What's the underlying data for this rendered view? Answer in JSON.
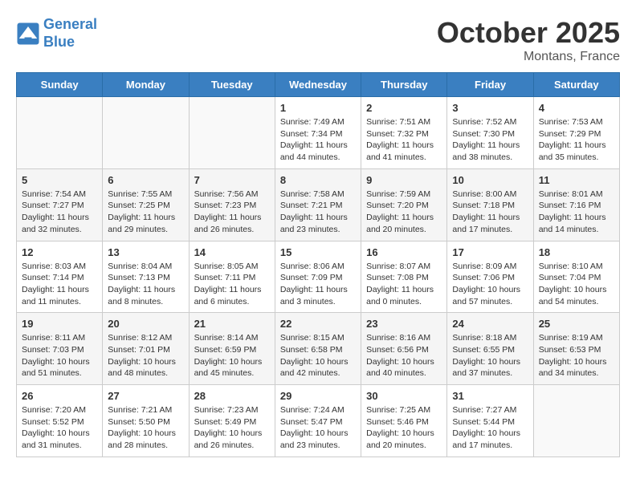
{
  "header": {
    "logo_line1": "General",
    "logo_line2": "Blue",
    "month": "October 2025",
    "location": "Montans, France"
  },
  "days_of_week": [
    "Sunday",
    "Monday",
    "Tuesday",
    "Wednesday",
    "Thursday",
    "Friday",
    "Saturday"
  ],
  "weeks": [
    [
      {
        "day": "",
        "info": ""
      },
      {
        "day": "",
        "info": ""
      },
      {
        "day": "",
        "info": ""
      },
      {
        "day": "1",
        "info": "Sunrise: 7:49 AM\nSunset: 7:34 PM\nDaylight: 11 hours and 44 minutes."
      },
      {
        "day": "2",
        "info": "Sunrise: 7:51 AM\nSunset: 7:32 PM\nDaylight: 11 hours and 41 minutes."
      },
      {
        "day": "3",
        "info": "Sunrise: 7:52 AM\nSunset: 7:30 PM\nDaylight: 11 hours and 38 minutes."
      },
      {
        "day": "4",
        "info": "Sunrise: 7:53 AM\nSunset: 7:29 PM\nDaylight: 11 hours and 35 minutes."
      }
    ],
    [
      {
        "day": "5",
        "info": "Sunrise: 7:54 AM\nSunset: 7:27 PM\nDaylight: 11 hours and 32 minutes."
      },
      {
        "day": "6",
        "info": "Sunrise: 7:55 AM\nSunset: 7:25 PM\nDaylight: 11 hours and 29 minutes."
      },
      {
        "day": "7",
        "info": "Sunrise: 7:56 AM\nSunset: 7:23 PM\nDaylight: 11 hours and 26 minutes."
      },
      {
        "day": "8",
        "info": "Sunrise: 7:58 AM\nSunset: 7:21 PM\nDaylight: 11 hours and 23 minutes."
      },
      {
        "day": "9",
        "info": "Sunrise: 7:59 AM\nSunset: 7:20 PM\nDaylight: 11 hours and 20 minutes."
      },
      {
        "day": "10",
        "info": "Sunrise: 8:00 AM\nSunset: 7:18 PM\nDaylight: 11 hours and 17 minutes."
      },
      {
        "day": "11",
        "info": "Sunrise: 8:01 AM\nSunset: 7:16 PM\nDaylight: 11 hours and 14 minutes."
      }
    ],
    [
      {
        "day": "12",
        "info": "Sunrise: 8:03 AM\nSunset: 7:14 PM\nDaylight: 11 hours and 11 minutes."
      },
      {
        "day": "13",
        "info": "Sunrise: 8:04 AM\nSunset: 7:13 PM\nDaylight: 11 hours and 8 minutes."
      },
      {
        "day": "14",
        "info": "Sunrise: 8:05 AM\nSunset: 7:11 PM\nDaylight: 11 hours and 6 minutes."
      },
      {
        "day": "15",
        "info": "Sunrise: 8:06 AM\nSunset: 7:09 PM\nDaylight: 11 hours and 3 minutes."
      },
      {
        "day": "16",
        "info": "Sunrise: 8:07 AM\nSunset: 7:08 PM\nDaylight: 11 hours and 0 minutes."
      },
      {
        "day": "17",
        "info": "Sunrise: 8:09 AM\nSunset: 7:06 PM\nDaylight: 10 hours and 57 minutes."
      },
      {
        "day": "18",
        "info": "Sunrise: 8:10 AM\nSunset: 7:04 PM\nDaylight: 10 hours and 54 minutes."
      }
    ],
    [
      {
        "day": "19",
        "info": "Sunrise: 8:11 AM\nSunset: 7:03 PM\nDaylight: 10 hours and 51 minutes."
      },
      {
        "day": "20",
        "info": "Sunrise: 8:12 AM\nSunset: 7:01 PM\nDaylight: 10 hours and 48 minutes."
      },
      {
        "day": "21",
        "info": "Sunrise: 8:14 AM\nSunset: 6:59 PM\nDaylight: 10 hours and 45 minutes."
      },
      {
        "day": "22",
        "info": "Sunrise: 8:15 AM\nSunset: 6:58 PM\nDaylight: 10 hours and 42 minutes."
      },
      {
        "day": "23",
        "info": "Sunrise: 8:16 AM\nSunset: 6:56 PM\nDaylight: 10 hours and 40 minutes."
      },
      {
        "day": "24",
        "info": "Sunrise: 8:18 AM\nSunset: 6:55 PM\nDaylight: 10 hours and 37 minutes."
      },
      {
        "day": "25",
        "info": "Sunrise: 8:19 AM\nSunset: 6:53 PM\nDaylight: 10 hours and 34 minutes."
      }
    ],
    [
      {
        "day": "26",
        "info": "Sunrise: 7:20 AM\nSunset: 5:52 PM\nDaylight: 10 hours and 31 minutes."
      },
      {
        "day": "27",
        "info": "Sunrise: 7:21 AM\nSunset: 5:50 PM\nDaylight: 10 hours and 28 minutes."
      },
      {
        "day": "28",
        "info": "Sunrise: 7:23 AM\nSunset: 5:49 PM\nDaylight: 10 hours and 26 minutes."
      },
      {
        "day": "29",
        "info": "Sunrise: 7:24 AM\nSunset: 5:47 PM\nDaylight: 10 hours and 23 minutes."
      },
      {
        "day": "30",
        "info": "Sunrise: 7:25 AM\nSunset: 5:46 PM\nDaylight: 10 hours and 20 minutes."
      },
      {
        "day": "31",
        "info": "Sunrise: 7:27 AM\nSunset: 5:44 PM\nDaylight: 10 hours and 17 minutes."
      },
      {
        "day": "",
        "info": ""
      }
    ]
  ]
}
